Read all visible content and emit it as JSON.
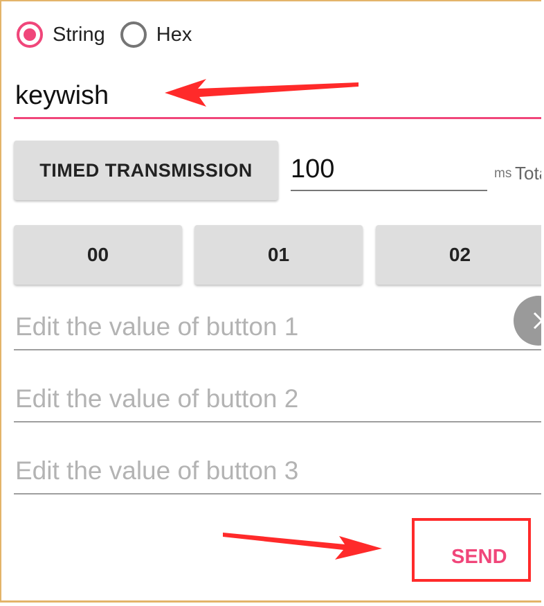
{
  "mode": {
    "options": [
      {
        "label": "String",
        "checked": true
      },
      {
        "label": "Hex",
        "checked": false
      }
    ]
  },
  "main_input": {
    "value": "keywish"
  },
  "timed": {
    "button_label": "TIMED TRANSMISSION",
    "interval_value": "100",
    "unit": "ms",
    "total_label": "Total"
  },
  "quick_buttons": [
    "00",
    "01",
    "02"
  ],
  "edit_fields": [
    {
      "placeholder": "Edit the value of button 1"
    },
    {
      "placeholder": "Edit the value of button 2"
    },
    {
      "placeholder": "Edit the value of button 3"
    }
  ],
  "send": {
    "label": "SEND"
  },
  "colors": {
    "accent": "#f0467a",
    "annotation": "#ff2a2a",
    "button_bg": "#dedede"
  }
}
